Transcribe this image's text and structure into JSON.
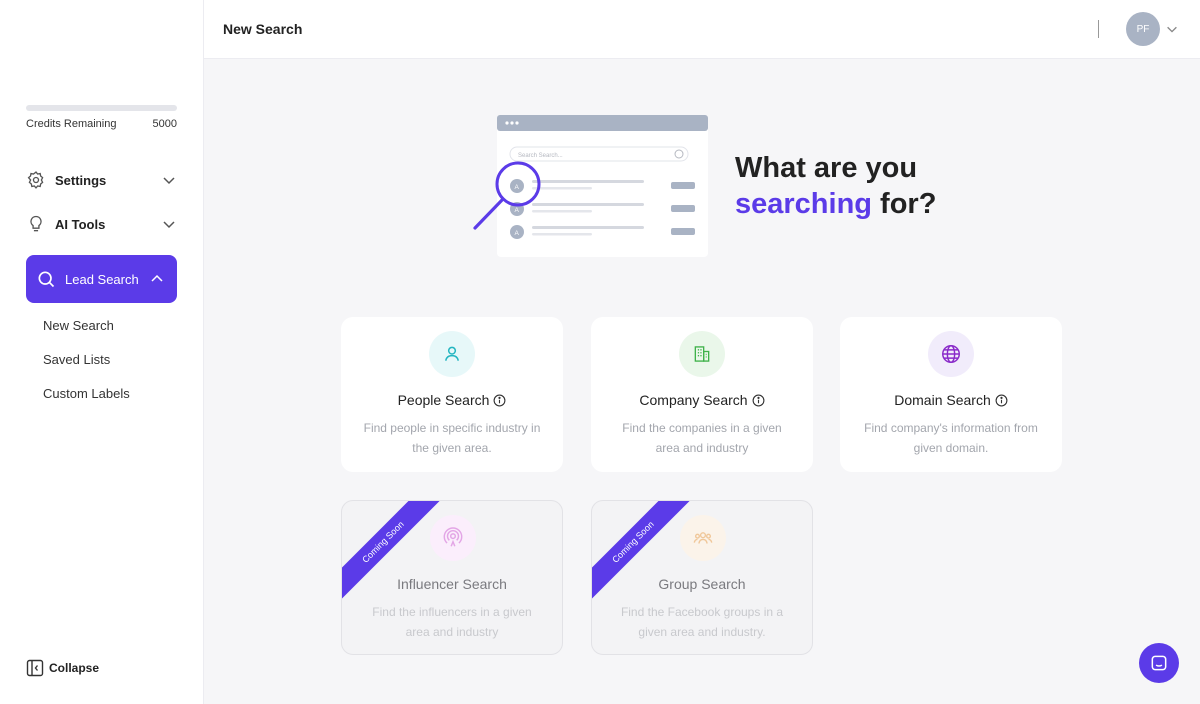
{
  "sidebar": {
    "credits_label": "Credits Remaining",
    "credits_value": "5000",
    "settings_label": "Settings",
    "aitools_label": "AI Tools",
    "lead_search_label": "Lead Search",
    "sub_items": [
      "New Search",
      "Saved Lists",
      "Custom Labels"
    ],
    "collapse_label": "Collapse"
  },
  "header": {
    "title": "New Search",
    "avatar_initials": "PF"
  },
  "hero": {
    "line1": "What are you",
    "accent": "searching",
    "line2_rest": " for?",
    "search_placeholder": "Search Search...",
    "avatar_letter": "A"
  },
  "cards": [
    {
      "title": "People Search",
      "desc": "Find people in specific industry in the given area.",
      "icon": "person-icon"
    },
    {
      "title": "Company Search",
      "desc": "Find the companies in a given area and industry",
      "icon": "building-icon"
    },
    {
      "title": "Domain Search",
      "desc": "Find company's information from given domain.",
      "icon": "globe-icon"
    },
    {
      "title": "Influencer Search",
      "desc": "Find the influencers in a given area and industry",
      "icon": "broadcast-icon",
      "ribbon": "Coming Soon"
    },
    {
      "title": "Group Search",
      "desc": "Find the Facebook groups in a given area and industry.",
      "icon": "group-icon",
      "ribbon": "Coming Soon"
    }
  ],
  "colors": {
    "accent": "#5b3be8",
    "people_bg": "#e7f8f9",
    "company_bg": "#eaf7ea",
    "domain_bg": "#f1ecfb"
  }
}
